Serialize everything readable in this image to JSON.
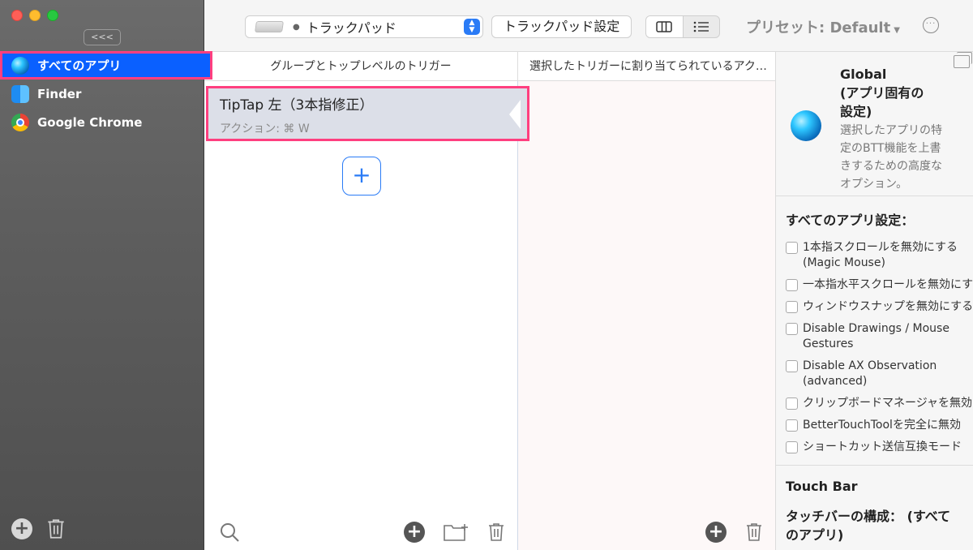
{
  "sidebar": {
    "collapse_label": "<<<",
    "apps": [
      {
        "label": "すべてのアプリ",
        "icon": "globe-icon",
        "selected": true
      },
      {
        "label": "Finder",
        "icon": "finder-icon",
        "selected": false
      },
      {
        "label": "Google Chrome",
        "icon": "chrome-icon",
        "selected": false
      }
    ]
  },
  "toolbar": {
    "device_label": "トラックパッド",
    "device_settings_label": "トラックパッド設定",
    "preset_label": "プリセット: Default"
  },
  "columns": {
    "triggers_header": "グループとトップレベルのトリガー",
    "actions_header": "選択したトリガーに割り当てられているアク…"
  },
  "triggers": [
    {
      "title": "TipTap 左（3本指修正）",
      "subtitle": "アクション: ⌘ W"
    }
  ],
  "right_panel": {
    "global_title": "Global\n(アプリ固有の設定)",
    "global_title_lines": [
      "Global",
      "(アプリ固有の",
      "設定)"
    ],
    "global_desc": "選択したアプリの特定のBTT機能を上書きするための高度なオプション。",
    "global_desc_lines": [
      "選択したアプリの特",
      "定のBTT機能を上書",
      "きするための高度な",
      "オプション。"
    ],
    "all_apps_settings_header": "すべてのアプリ設定：",
    "options": [
      {
        "label": "1本指スクロールを無効にする(Magic Mouse)",
        "lines": [
          "1本指スクロールを無効にする",
          "(Magic Mouse)"
        ],
        "checked": false
      },
      {
        "label": "一本指水平スクロールを無効にす",
        "lines": [
          "一本指水平スクロールを無効にす"
        ],
        "checked": false
      },
      {
        "label": "ウィンドウスナップを無効にする",
        "lines": [
          "ウィンドウスナップを無効にする"
        ],
        "checked": false
      },
      {
        "label": "Disable Drawings / Mouse Gestures",
        "lines": [
          "Disable Drawings / Mouse",
          "Gestures"
        ],
        "checked": false
      },
      {
        "label": "Disable AX Observation (advanced)",
        "lines": [
          "Disable AX Observation",
          "(advanced)"
        ],
        "checked": false
      },
      {
        "label": "クリップボードマネージャを無効",
        "lines": [
          "クリップボードマネージャを無効"
        ],
        "checked": false
      },
      {
        "label": "BetterTouchToolを完全に無効",
        "lines": [
          "BetterTouchToolを完全に無効"
        ],
        "checked": false
      },
      {
        "label": "ショートカット送信互換モード",
        "lines": [
          "ショートカット送信互換モード"
        ],
        "checked": false
      }
    ],
    "touchbar_header": "Touch Bar",
    "touchbar_config_label": "タッチバーの構成： (すべてのアプリ)",
    "touchbar_config_lines": [
      "タッチバーの構成： (すべて",
      "のアプリ)"
    ]
  },
  "colors": {
    "selection_blue": "#0a60ff",
    "highlight_pink": "#ff3f7f",
    "accent_blue": "#2a7bf6"
  }
}
